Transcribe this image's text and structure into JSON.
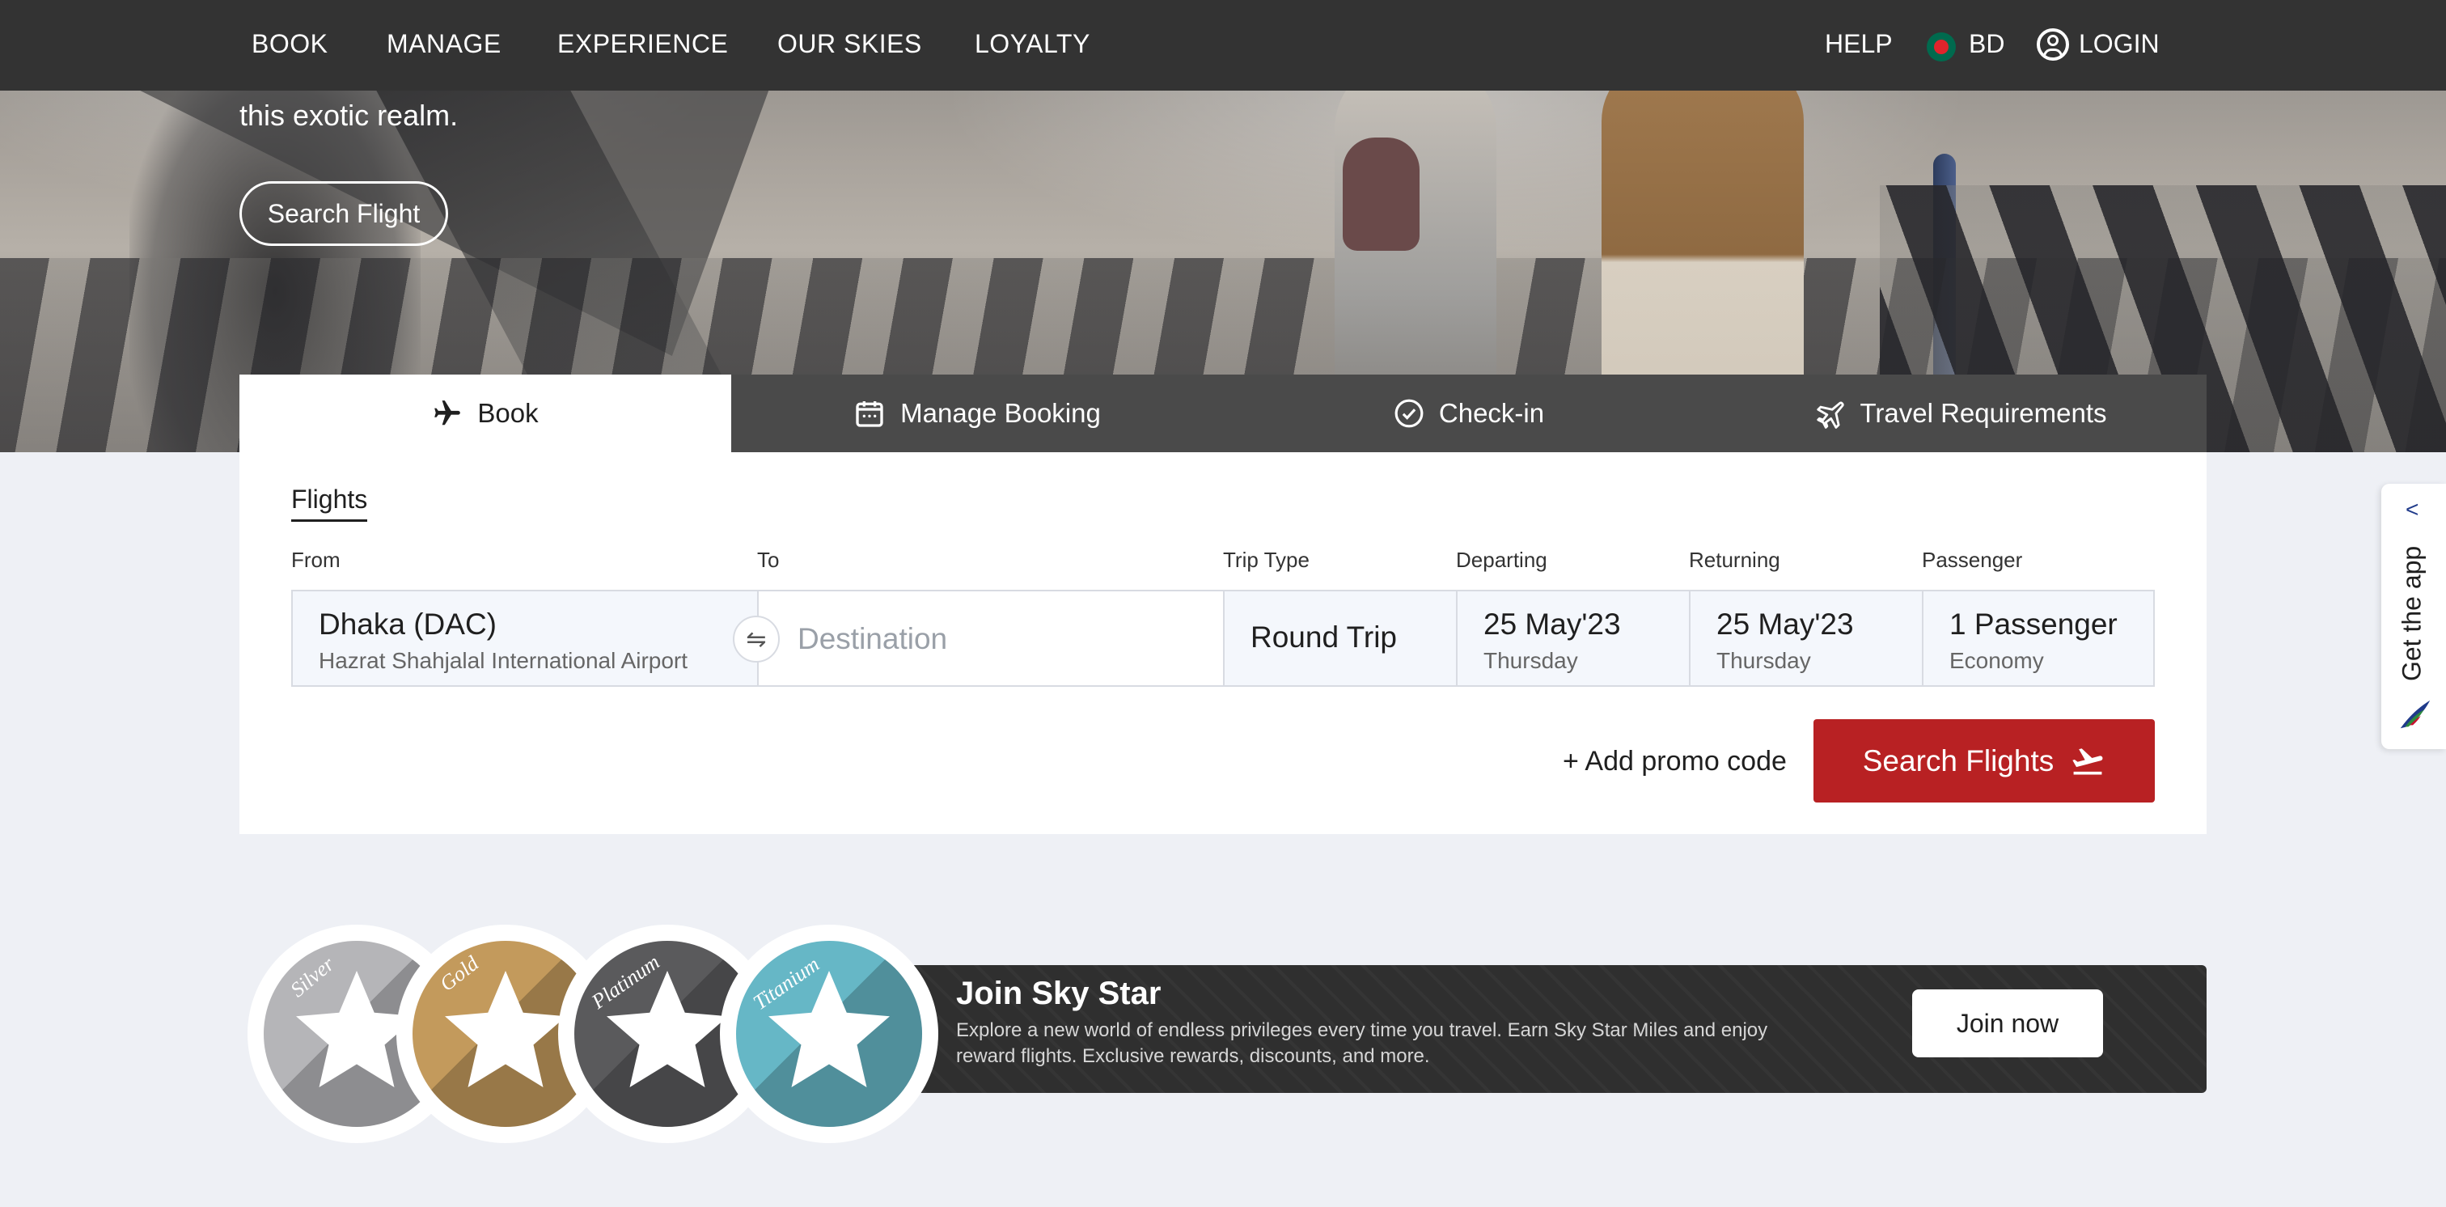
{
  "nav": {
    "items": [
      "BOOK",
      "MANAGE",
      "EXPERIENCE",
      "OUR SKIES",
      "LOYALTY"
    ],
    "help": "HELP",
    "region": "BD",
    "login": "LOGIN"
  },
  "hero": {
    "text": "this exotic realm.",
    "button": "Search Flight"
  },
  "tabs": [
    {
      "label": "Book",
      "icon": "airplane-icon"
    },
    {
      "label": "Manage Booking",
      "icon": "calendar-icon"
    },
    {
      "label": "Check-in",
      "icon": "check-circle-icon"
    },
    {
      "label": "Travel Requirements",
      "icon": "plane-ticket-icon"
    }
  ],
  "booking": {
    "section_title": "Flights",
    "labels": {
      "from": "From",
      "to": "To",
      "trip_type": "Trip Type",
      "departing": "Departing",
      "returning": "Returning",
      "passenger": "Passenger"
    },
    "from": {
      "value": "Dhaka (DAC)",
      "sub": "Hazrat Shahjalal International Airport"
    },
    "to": {
      "placeholder": "Destination"
    },
    "swap_icon": "⇋",
    "trip_type": "Round Trip",
    "departing": {
      "date": "25 May'23",
      "day": "Thursday"
    },
    "returning": {
      "date": "25 May'23",
      "day": "Thursday"
    },
    "passenger": {
      "count": "1 Passenger",
      "class": "Economy"
    },
    "promo": "+ Add promo code",
    "search_button": "Search Flights"
  },
  "skystar": {
    "title": "Join Sky Star",
    "description": "Explore a new world of endless privileges every time you travel. Earn Sky Star Miles and enjoy reward flights. Exclusive rewards, discounts, and more.",
    "join_button": "Join now",
    "tiers": [
      {
        "name": "Silver",
        "color": "#b5b5b8"
      },
      {
        "name": "Gold",
        "color": "#c39a5c"
      },
      {
        "name": "Platinum",
        "color": "#5a5a5c"
      },
      {
        "name": "Titanium",
        "color": "#66b7c6"
      }
    ]
  },
  "app_tab": {
    "chevron": "<",
    "label": "Get the app"
  },
  "colors": {
    "nav_bg": "#333333",
    "accent_red": "#b82123",
    "page_bg": "#eef0f5"
  }
}
